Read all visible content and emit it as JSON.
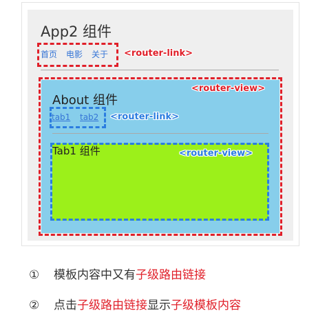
{
  "app": {
    "title": "App2 组件",
    "links": [
      "首页",
      "电影",
      "关于"
    ],
    "link_tag": "<router-link>",
    "view_tag": "<router-view>"
  },
  "about": {
    "title": "About 组件",
    "links": [
      "tab1",
      "tab2"
    ],
    "link_tag": "<router-link>",
    "view_tag": "<router-view>"
  },
  "tab1": {
    "title": "Tab1 组件"
  },
  "notes": [
    {
      "num": "①",
      "parts": [
        "模板内容中又有",
        "子级路由链接"
      ]
    },
    {
      "num": "②",
      "parts": [
        "点击",
        "子级路由链接",
        "显示",
        "子级模板内容"
      ]
    }
  ],
  "colors": {
    "red_accent": "#e0202a",
    "blue_accent": "#2b7de0",
    "about_bg": "#87ceeb",
    "tab_bg": "#9cf01a"
  }
}
